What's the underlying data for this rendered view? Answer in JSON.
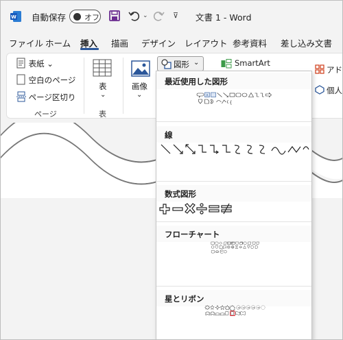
{
  "titlebar": {
    "autosave_label": "自動保存",
    "autosave_state": "オフ",
    "doc_title": "文書 1  -  Word"
  },
  "tabs": [
    "ファイル",
    "ホーム",
    "挿入",
    "描画",
    "デザイン",
    "レイアウト",
    "参考資料",
    "差し込み文書"
  ],
  "active_tab": "挿入",
  "ribbon": {
    "cover_page": "表紙",
    "blank_page": "空白のページ",
    "page_break": "ページ区切り",
    "pages_group": "ページ",
    "table_label": "表",
    "tables_group": "表",
    "image_label": "画像",
    "shapes_label": "図形",
    "smartart_label": "SmartArt",
    "addins_label": "アド",
    "personal_label": "個人"
  },
  "shapes_menu": {
    "recent": "最近使用した図形",
    "lines": "線",
    "equation": "数式図形",
    "flowchart": "フローチャート",
    "stars": "星とリボン"
  },
  "colors": {
    "accent": "#2b579a",
    "highlight": "#e3000b",
    "save_purple": "#6b2d91"
  }
}
